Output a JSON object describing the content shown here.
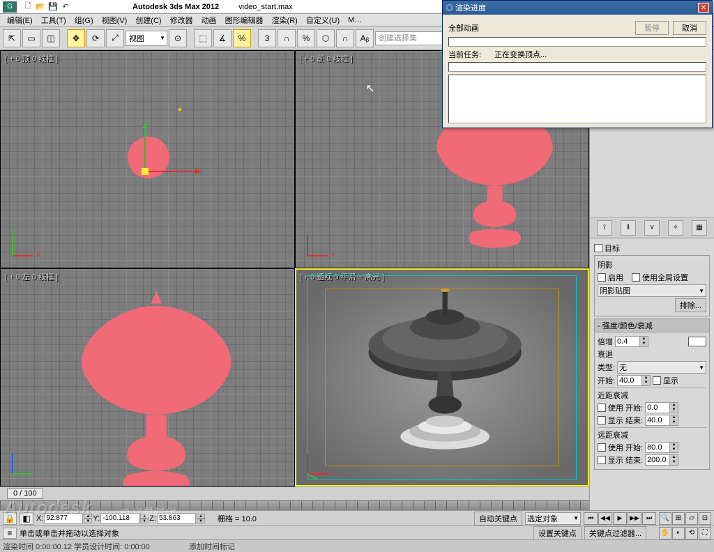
{
  "app": {
    "name": "Autodesk 3ds Max 2012",
    "file": "video_start.max"
  },
  "menus": [
    "编辑(E)",
    "工具(T)",
    "组(G)",
    "视图(V)",
    "创建(C)",
    "修改器",
    "动画",
    "图形编辑器",
    "渲染(R)",
    "自定义(U)",
    "M…"
  ],
  "toolbar": {
    "view_combo": "视图",
    "selset_label": "创建选择集"
  },
  "viewports": {
    "top": "[ + 0 顶 0 线框 ]",
    "front": "[ + 0 前 0 线框 ]",
    "left": "[ + 0 左 0 线框 ]",
    "persp": "[ + 0 透视 0 平滑 + 高光 ]"
  },
  "panel": {
    "target_chk": "目标",
    "shadow_hdr": "阴影",
    "enable": "启用",
    "use_global": "使用全局设置",
    "shadow_map": "阴影贴图",
    "exclude_btn": "排除...",
    "intensity_hdr": "强度/颜色/衰减",
    "multiplier_lbl": "倍增",
    "multiplier_val": "0.4",
    "decay_hdr": "衰退",
    "type_lbl": "类型:",
    "type_val": "无",
    "start_lbl": "开始:",
    "decay_start": "40.0",
    "show_lbl": "显示",
    "near_hdr": "近距衰减",
    "use_lbl": "使用",
    "near_start_lbl": "开始:",
    "near_start": "0.0",
    "near_end_lbl": "结束:",
    "near_end": "40.0",
    "far_hdr": "远距衰减",
    "far_start_lbl": "开始:",
    "far_start": "80.0",
    "far_end_lbl": "结束:",
    "far_end": "200.0"
  },
  "timeline": {
    "pos": "0 / 100"
  },
  "status": {
    "x_lbl": "X:",
    "x": "92.877",
    "y_lbl": "Y:",
    "y": "-100.118",
    "z_lbl": "Z:",
    "z": "53.863",
    "grid_lbl": "栅格 = 10.0",
    "autokey": "自动关键点",
    "selobj": "选定对象",
    "setkey": "设置关键点",
    "keyfilter": "关键点过滤器...",
    "addtag": "添加时间标记"
  },
  "status2": {
    "line1": "单击或单击并拖动以选择对象",
    "line2": "渲染时间 0:00:00.12   学员设计时间: 0:00:00"
  },
  "dialog": {
    "title": "渲染进度",
    "all_anim": "全部动画",
    "pause": "暂停",
    "cancel": "取消",
    "cur_task": "当前任务:",
    "task_text": "正在变换顶点..."
  },
  "watermark": "Autodesk",
  "watermark2": "@义量时代"
}
